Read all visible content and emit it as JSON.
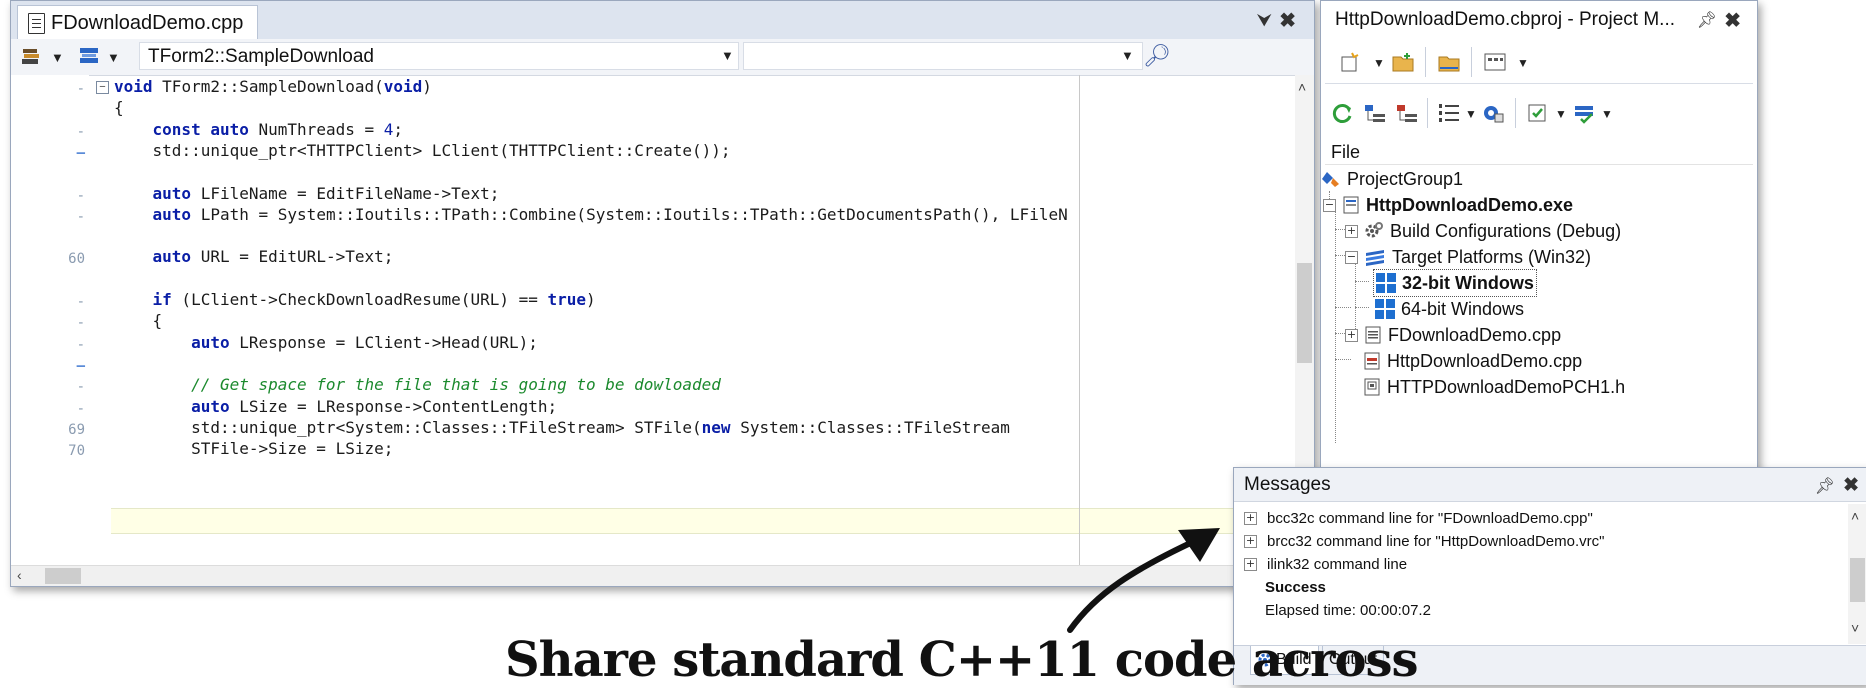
{
  "editor": {
    "tab_title": "FDownloadDemo.cpp",
    "method_combo": "TForm2::SampleDownload",
    "gutter": [
      "-",
      "",
      "-",
      "–",
      "",
      "-",
      "-",
      "",
      "60",
      "",
      "-",
      "-",
      "-",
      "–",
      "-",
      "-",
      "69",
      "70"
    ],
    "code_lines": [
      "void TForm2::SampleDownload(void)",
      "{",
      "    const auto NumThreads = 4;",
      "    std::unique_ptr<THTTPClient> LClient(THTTPClient::Create());",
      "",
      "    auto LFileName = EditFileName->Text;",
      "    auto LPath = System::Ioutils::TPath::Combine(System::Ioutils::TPath::GetDocumentsPath(), LFileN",
      "",
      "    auto URL = EditURL->Text;",
      "",
      "    if (LClient->CheckDownloadResume(URL) == true)",
      "    {",
      "        auto LResponse = LClient->Head(URL);",
      "",
      "        // Get space for the file that is going to be dowloaded",
      "        auto LSize = LResponse->ContentLength;",
      "        std::unique_ptr<System::Classes::TFileStream> STFile(new System::Classes::TFileStream",
      "        STFile->Size = LSize;",
      ""
    ]
  },
  "project_manager": {
    "title": "HttpDownloadDemo.cbproj - Project M...",
    "column_header": "File",
    "tree": [
      {
        "label": "ProjectGroup1",
        "icon": "project-group-icon"
      },
      {
        "label": "HttpDownloadDemo.exe",
        "icon": "exe-icon",
        "bold": true
      },
      {
        "label": "Build Configurations (Debug)",
        "icon": "gear-icon"
      },
      {
        "label": "Target Platforms (Win32)",
        "icon": "platforms-icon"
      },
      {
        "label": "32-bit Windows",
        "icon": "windows-icon",
        "bold": true
      },
      {
        "label": "64-bit Windows",
        "icon": "windows-icon"
      },
      {
        "label": "FDownloadDemo.cpp",
        "icon": "cpp-file-icon"
      },
      {
        "label": "HttpDownloadDemo.cpp",
        "icon": "cpp-file-icon"
      },
      {
        "label": "HTTPDownloadDemoPCH1.h",
        "icon": "header-file-icon"
      }
    ]
  },
  "messages": {
    "title": "Messages",
    "rows": [
      "bcc32c command line for \"FDownloadDemo.cpp\"",
      "brcc32 command line for \"HttpDownloadDemo.vrc\"",
      "ilink32 command line"
    ],
    "success": "Success",
    "elapsed": "Elapsed time: 00:00:07.2",
    "tabs": [
      "Build",
      "Output"
    ]
  },
  "caption": "Share standard C++11 code across",
  "colors": {
    "keyword": "#0a1ea6",
    "comment": "#1c8a2e",
    "current_line": "#ffffe6",
    "windows_blue": "#1e6fd0"
  }
}
